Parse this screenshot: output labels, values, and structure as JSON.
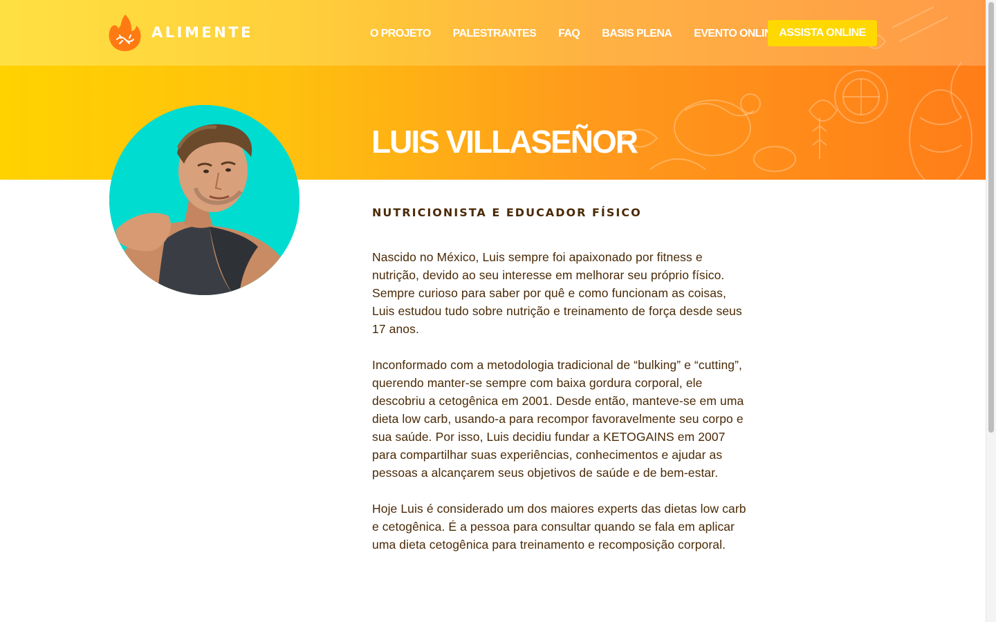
{
  "brand": {
    "name": "ALIMENTE",
    "logo_icon": "flame-logo-icon"
  },
  "nav": {
    "items": [
      "O PROJETO",
      "PALESTRANTES",
      "FAQ",
      "BASIS PLENA",
      "EVENTO ONLINE"
    ],
    "cta": "ASSISTA ONLINE"
  },
  "speaker": {
    "name": "LUIS VILLASEÑOR",
    "role": "NUTRICIONISTA E EDUCADOR FÍSICO",
    "bio": [
      "Nascido no México, Luis sempre foi apaixonado por fitness e nutrição, devido ao seu interesse em melhorar seu próprio físico. Sempre curioso para saber por quê e como funcionam as coisas, Luis estudou tudo sobre nutrição e treinamento de força desde seus 17 anos.",
      "Inconformado com a metodologia tradicional de “bulking” e “cutting”, querendo manter-se sempre com baixa gordura corporal, ele descobriu a cetogênica em 2001. Desde então, manteve-se em uma dieta low carb, usando-a para recompor favoravelmente seu corpo e sua saúde. Por isso, Luis decidiu fundar a KETOGAINS em 2007 para compartilhar suas experiências, conhecimentos e ajudar as pessoas a alcançarem seus objetivos de saúde e de bem-estar.",
      "Hoje Luis é considerado um dos maiores experts das dietas low carb e cetogênica. É a pessoa para consultar quando se fala em aplicar uma dieta cetogênica para treinamento e recomposição corporal."
    ]
  },
  "colors": {
    "brand_yellow": "#ffd200",
    "brand_orange": "#ff7d17",
    "cta_yellow": "#ffd800",
    "avatar_bg": "#00dcd0",
    "text_brown": "#4a2a06"
  }
}
